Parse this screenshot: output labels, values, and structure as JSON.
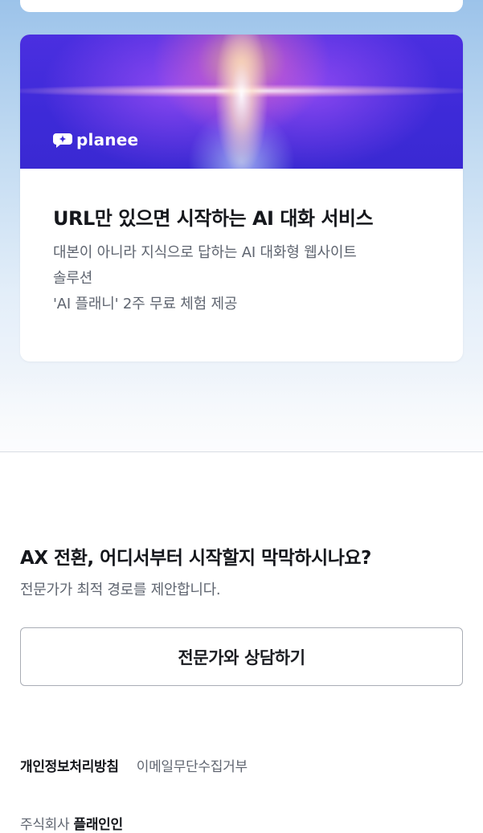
{
  "promo_card": {
    "logo_text": "planee",
    "title": "URL만 있으면 시작하는 AI 대화 서비스",
    "description": "대본이 아니라 지식으로 답하는 AI 대화형 웹사이트\n솔루션\n'AI 플래니' 2주 무료 체험 제공"
  },
  "cta": {
    "title": "AX 전환, 어디서부터 시작할지 막막하시나요?",
    "subtitle": "전문가가 최적 경로를 제안합니다.",
    "button_label": "전문가와 상담하기"
  },
  "footer": {
    "privacy_label": "개인정보처리방침",
    "email_label": "이메일무단수집거부",
    "company_prefix": "주식회사",
    "company_name": "플래인인"
  },
  "colors": {
    "banner_primary": "#3d2ad8",
    "text_primary": "#15171c",
    "text_secondary": "#5f6570",
    "button_border": "#a9adb5"
  }
}
